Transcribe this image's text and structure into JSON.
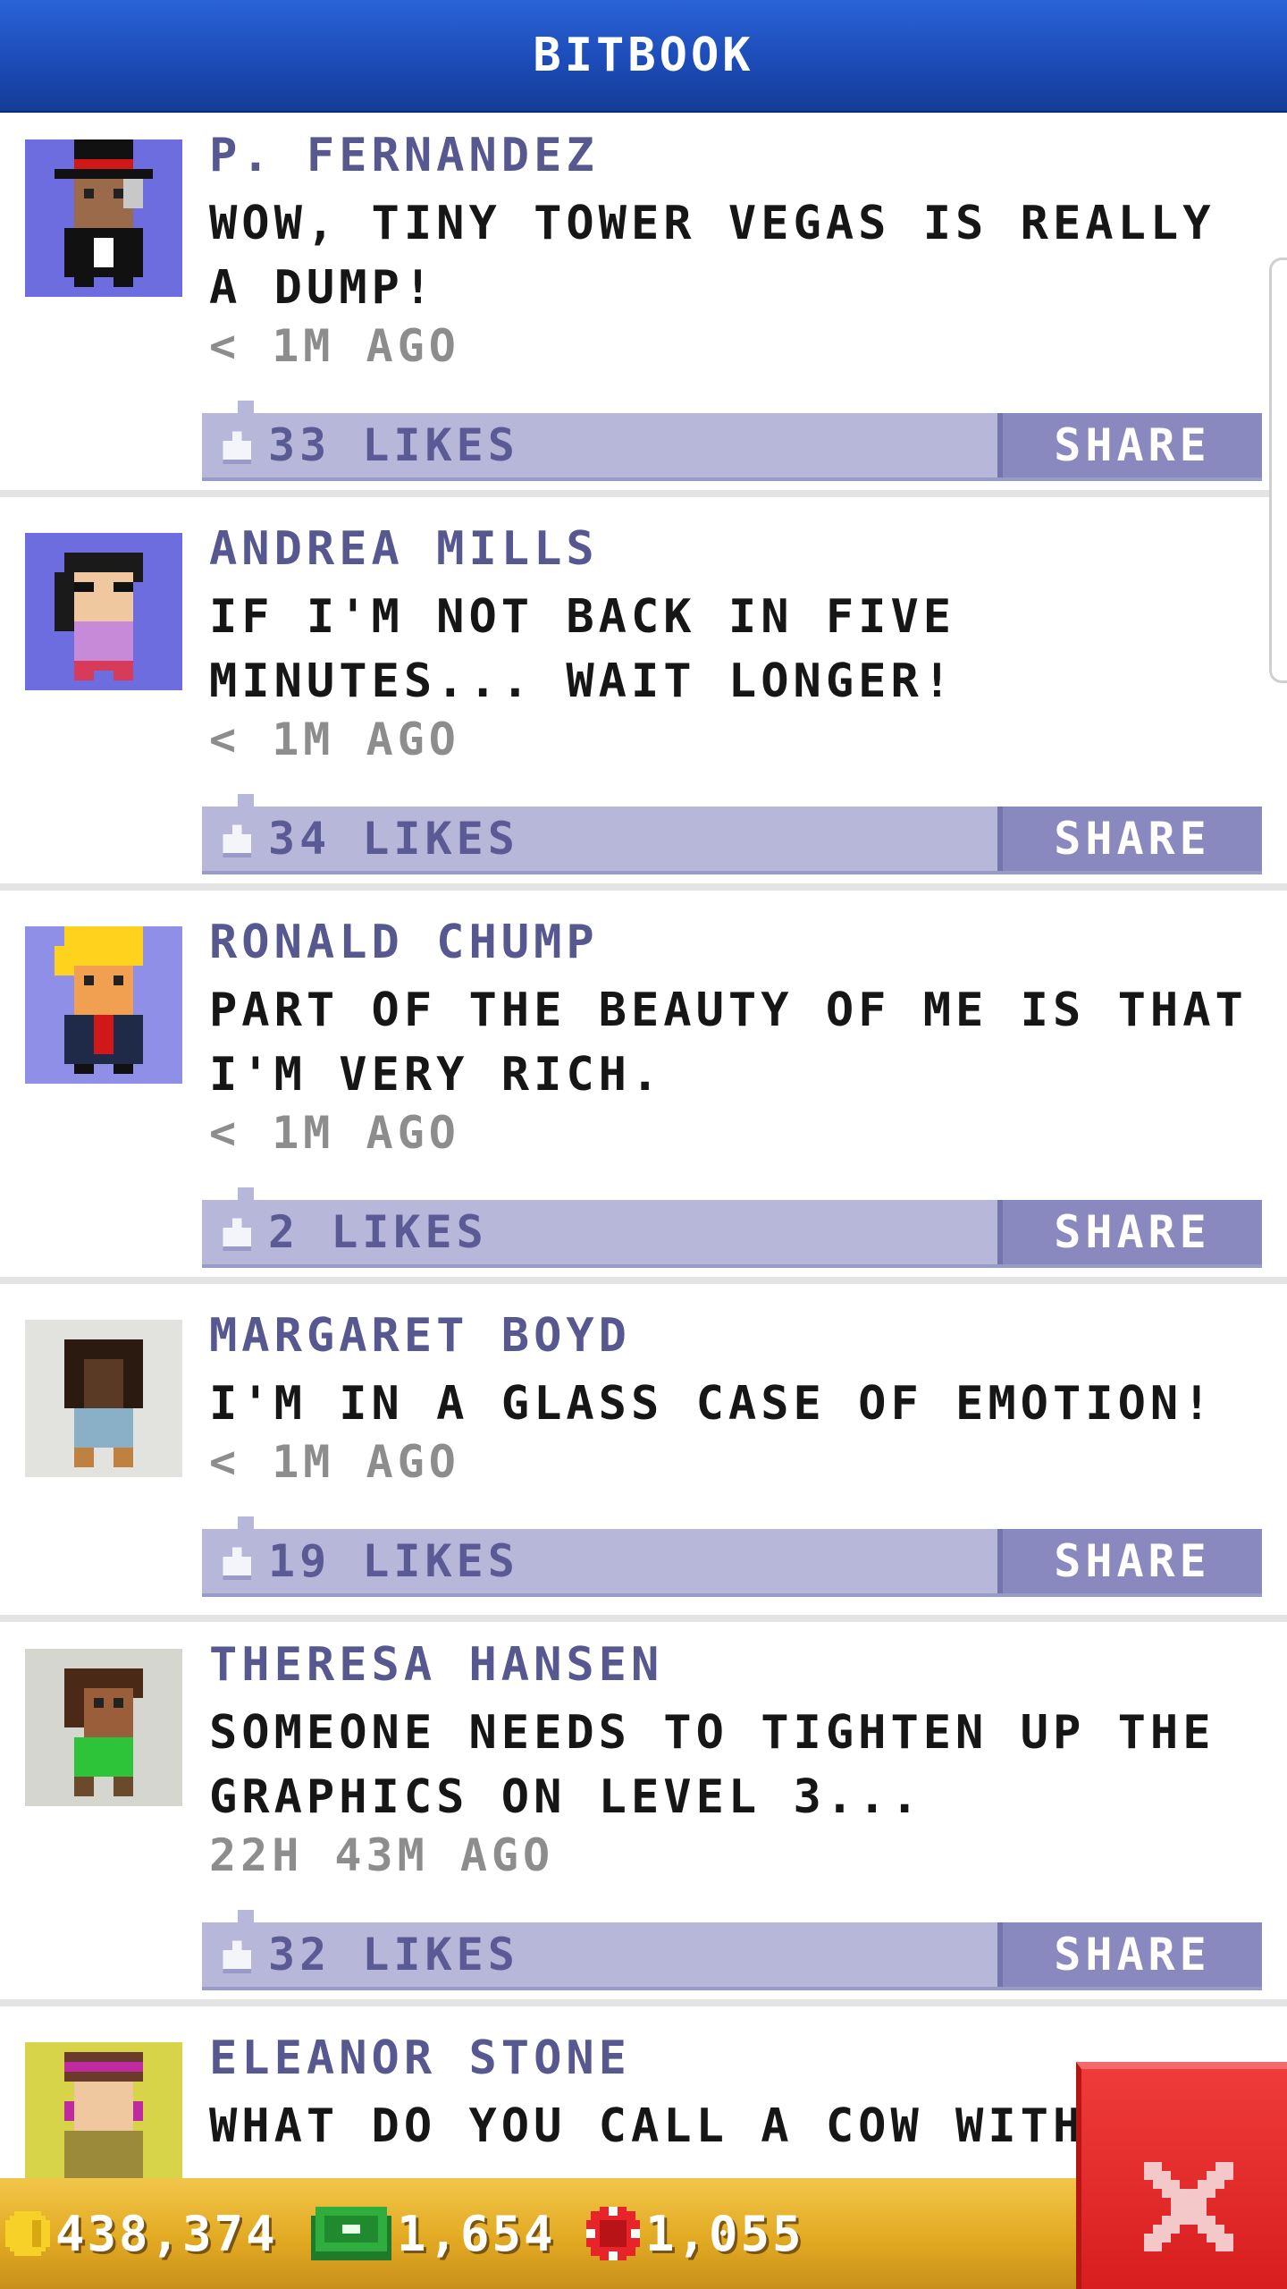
{
  "header": {
    "title": "BITBOOK"
  },
  "posts": [
    {
      "author": "P. FERNANDEZ",
      "message": "WOW, TINY TOWER VEGAS IS REALLY A DUMP!",
      "time": "< 1M AGO",
      "likes": "33 LIKES",
      "share": "SHARE",
      "avatar_bg": "#6d6de0"
    },
    {
      "author": "ANDREA MILLS",
      "message": "IF I'M NOT BACK IN FIVE MINUTES... WAIT LONGER!",
      "time": "< 1M AGO",
      "likes": "34 LIKES",
      "share": "SHARE",
      "avatar_bg": "#6d6de0"
    },
    {
      "author": "RONALD CHUMP",
      "message": "PART OF THE BEAUTY OF ME IS THAT I'M VERY RICH.",
      "time": "< 1M AGO",
      "likes": "2 LIKES",
      "share": "SHARE",
      "avatar_bg": "#8f8fe8"
    },
    {
      "author": "MARGARET BOYD",
      "message": "I'M IN A GLASS CASE OF EMOTION!",
      "time": "< 1M AGO",
      "likes": "19 LIKES",
      "share": "SHARE",
      "avatar_bg": "#e2e2de"
    },
    {
      "author": "THERESA HANSEN",
      "message": "SOMEONE NEEDS TO TIGHTEN UP THE GRAPHICS ON LEVEL 3...",
      "time": "22H 43M AGO",
      "likes": "32 LIKES",
      "share": "SHARE",
      "avatar_bg": "#d6d6d0"
    },
    {
      "author": "ELEANOR STONE",
      "message": "WHAT DO YOU CALL A COW WITH",
      "avatar_bg": "#d8d44a"
    }
  ],
  "stats": {
    "coins": "438,374",
    "bux": "1,654",
    "chips": "1,055"
  },
  "icons": {
    "close": "close-icon",
    "coin": "coin-icon",
    "bux": "bux-icon",
    "chip": "chip-icon",
    "like": "thumbs-up-icon"
  },
  "colors": {
    "header": "#1c4cb8",
    "likebar": "#b7b7da",
    "share": "#8989bf",
    "author": "#56588f",
    "bottom_bar": "#e2aa22",
    "close": "#e02a2a"
  }
}
